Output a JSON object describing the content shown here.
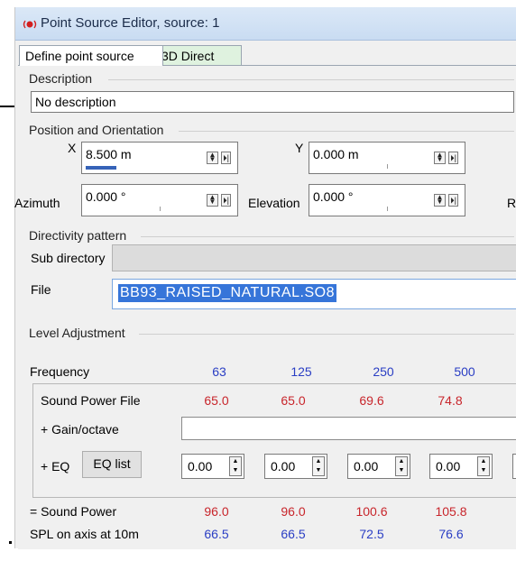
{
  "window": {
    "title": "Point Source Editor, source: 1",
    "icon": "speaker-source-icon"
  },
  "tabs": [
    {
      "label": "Define point source",
      "active": true
    },
    {
      "label": "3D Direct",
      "active": false
    }
  ],
  "description": {
    "group_label": "Description",
    "value": "No description"
  },
  "position": {
    "group_label": "Position and Orientation",
    "x_label": "X",
    "x_value": "8.500 m",
    "x_slider_level": 0.25,
    "y_label": "Y",
    "y_value": "0.000 m",
    "azimuth_label": "Azimuth",
    "azimuth_value": "0.000 °",
    "elevation_label": "Elevation",
    "elevation_value": "0.000 °",
    "cut_label": "R"
  },
  "directivity": {
    "group_label": "Directivity pattern",
    "subdir_label": "Sub directory",
    "subdir_value": "",
    "file_label": "File",
    "file_value": "BB93_RAISED_NATURAL.SO8"
  },
  "level": {
    "group_label": "Level Adjustment",
    "frequency_label": "Frequency",
    "frequencies": [
      "63",
      "125",
      "250",
      "500"
    ],
    "swl_file_label": "Sound Power File",
    "swl_file_values": [
      "65.0",
      "65.0",
      "69.6",
      "74.8"
    ],
    "gain_label": "+ Gain/octave",
    "eq_label": "+ EQ",
    "eq_button": "EQ list",
    "eq_values": [
      "0.00",
      "0.00",
      "0.00",
      "0.00"
    ],
    "sound_power_label": "= Sound Power",
    "sound_power_values": [
      "96.0",
      "96.0",
      "100.6",
      "105.8"
    ],
    "spl_label": "SPL on axis at 10m",
    "spl_values": [
      "66.5",
      "66.5",
      "72.5",
      "76.6"
    ]
  },
  "colors": {
    "red_values": "#c8252b",
    "blue_values": "#2a3ec4",
    "file_selection": "#3675d9"
  }
}
